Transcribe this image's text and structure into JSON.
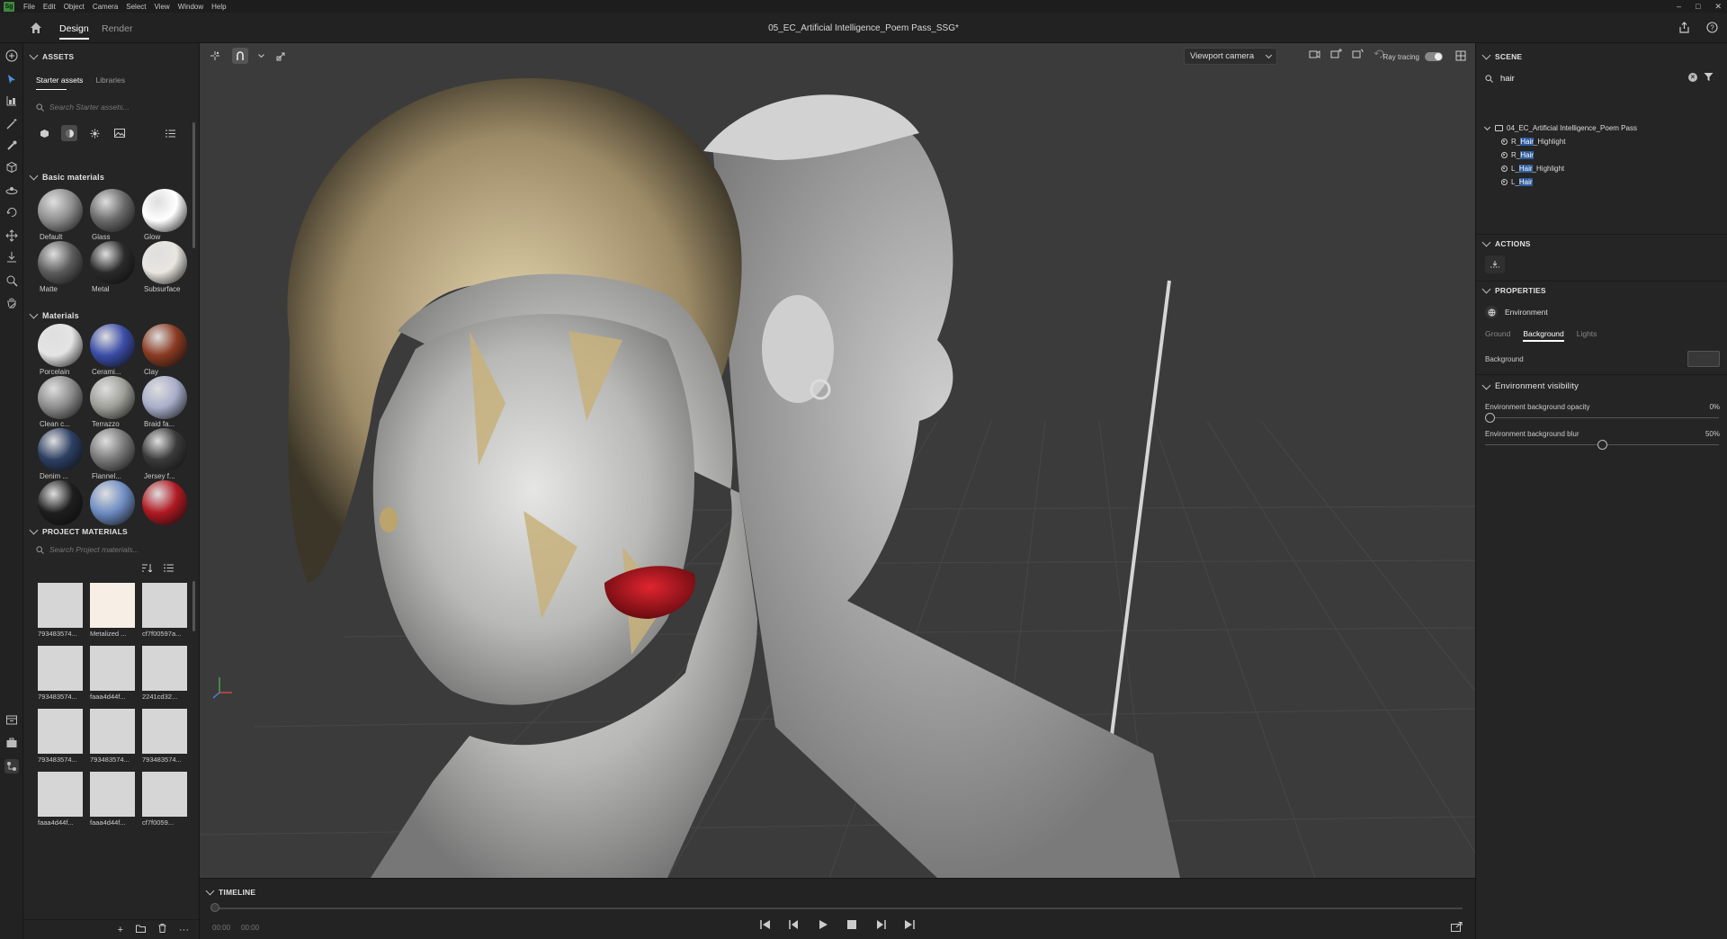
{
  "app": {
    "logo": "Sg",
    "menu": [
      "File",
      "Edit",
      "Object",
      "Camera",
      "Select",
      "View",
      "Window",
      "Help"
    ],
    "tabs": {
      "design": "Design",
      "render": "Render"
    },
    "document_title": "05_EC_Artificial Intelligence_Poem Pass_SSG*",
    "window_controls": [
      "–",
      "□",
      "✕"
    ]
  },
  "assets": {
    "header": "ASSETS",
    "subtabs": {
      "starter": "Starter assets",
      "libraries": "Libraries"
    },
    "search_placeholder": "Search Starter assets...",
    "basic_materials": {
      "header": "Basic materials",
      "items": [
        {
          "label": "Default",
          "color": "#8e8e8e"
        },
        {
          "label": "Glass",
          "color": "#6a6a6a"
        },
        {
          "label": "Glow",
          "color": "#ffffff"
        },
        {
          "label": "Matte",
          "color": "#5c5c5c"
        },
        {
          "label": "Metal",
          "color": "#2a2a2a"
        },
        {
          "label": "Subsurface",
          "color": "#e9e6e0"
        }
      ]
    },
    "materials": {
      "header": "Materials",
      "items": [
        {
          "label": "Porcelain",
          "color": "#e4e4e4"
        },
        {
          "label": "Cerami...",
          "color": "#3b4da8"
        },
        {
          "label": "Clay",
          "color": "#8a3b22"
        },
        {
          "label": "Clean c...",
          "color": "#8c8c8c"
        },
        {
          "label": "Terrazzo",
          "color": "#9e9e98"
        },
        {
          "label": "Braid fa...",
          "color": "#a8adc9"
        },
        {
          "label": "Denim ...",
          "color": "#2c3f63"
        },
        {
          "label": "Flannel...",
          "color": "#787878"
        },
        {
          "label": "Jersey f...",
          "color": "#3a3a3a"
        },
        {
          "label": "",
          "color": "#1e1e1e"
        },
        {
          "label": "",
          "color": "#6e8cc2"
        },
        {
          "label": "",
          "color": "#b01922"
        }
      ]
    },
    "project_materials": {
      "header": "PROJECT MATERIALS",
      "search_placeholder": "Search Project materials...",
      "items": [
        {
          "label": "793483574...",
          "color": "#d6d6d6"
        },
        {
          "label": "Metalized ...",
          "color": "#f7efe6"
        },
        {
          "label": "cf7f00597a...",
          "color": "#d6d6d6"
        },
        {
          "label": "793483574...",
          "color": "#d6d6d6"
        },
        {
          "label": "faaa4d44f...",
          "color": "#d6d6d6"
        },
        {
          "label": "2241cd32...",
          "color": "#d6d6d6"
        },
        {
          "label": "793483574...",
          "color": "#d6d6d6"
        },
        {
          "label": "793483574...",
          "color": "#d6d6d6"
        },
        {
          "label": "793483574...",
          "color": "#d6d6d6"
        },
        {
          "label": "faaa4d44f...",
          "color": "#d6d6d6"
        },
        {
          "label": "faaa4d44f...",
          "color": "#d6d6d6"
        },
        {
          "label": "cf7f0059...",
          "color": "#d6d6d6"
        }
      ]
    },
    "bottom_actions": [
      "+",
      "⌂",
      "🗑",
      "···"
    ]
  },
  "viewport": {
    "camera": "Viewport camera",
    "ray_tracing_label": "Ray tracing",
    "ray_tracing_on": true
  },
  "timeline": {
    "header": "TIMELINE",
    "time_start": "00:00",
    "time_end": "00:00"
  },
  "scene": {
    "header": "SCENE",
    "search_value": "hair",
    "tree": {
      "root": "04_EC_Artificial Intelligence_Poem Pass",
      "children": [
        {
          "pre": "R_",
          "match": "Hair",
          "post": "_Highlight"
        },
        {
          "pre": "R_",
          "match": "Hair",
          "post": ""
        },
        {
          "pre": "L_",
          "match": "Hair",
          "post": "_Highlight"
        },
        {
          "pre": "L_",
          "match": "Hair",
          "post": ""
        }
      ]
    }
  },
  "actions": {
    "header": "ACTIONS"
  },
  "properties": {
    "header": "PROPERTIES",
    "environment": "Environment",
    "tabs": {
      "ground": "Ground",
      "background": "Background",
      "lights": "Lights"
    },
    "background_label": "Background",
    "env_visibility": "Environment visibility",
    "opacity": {
      "label": "Environment background opacity",
      "value": "0%",
      "fraction": 0
    },
    "blur": {
      "label": "Environment background blur",
      "value": "50%",
      "fraction": 0.5
    }
  },
  "colors": {
    "accent_highlight": "#2e5c9a",
    "viewport_bg": "#3b3b3b",
    "panel_bg": "#252525"
  }
}
